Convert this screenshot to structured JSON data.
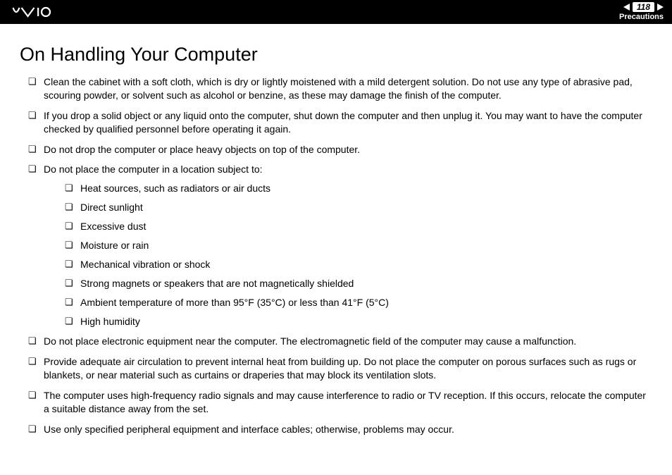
{
  "header": {
    "page_number": "118",
    "section": "Precautions"
  },
  "title": "On Handling Your Computer",
  "items": [
    "Clean the cabinet with a soft cloth, which is dry or lightly moistened with a mild detergent solution. Do not use any type of abrasive pad, scouring powder, or solvent such as alcohol or benzine, as these may damage the finish of the computer.",
    "If you drop a solid object or any liquid onto the computer, shut down the computer and then unplug it. You may want to have the computer checked by qualified personnel before operating it again.",
    "Do not drop the computer or place heavy objects on top of the computer.",
    "Do not place the computer in a location subject to:",
    "Do not place electronic equipment near the computer. The electromagnetic field of the computer may cause a malfunction.",
    "Provide adequate air circulation to prevent internal heat from building up. Do not place the computer on porous surfaces such as rugs or blankets, or near material such as curtains or draperies that may block its ventilation slots.",
    "The computer uses high-frequency radio signals and may cause interference to radio or TV reception. If this occurs, relocate the computer a suitable distance away from the set.",
    "Use only specified peripheral equipment and interface cables; otherwise, problems may occur."
  ],
  "subitems": [
    "Heat sources, such as radiators or air ducts",
    "Direct sunlight",
    "Excessive dust",
    "Moisture or rain",
    "Mechanical vibration or shock",
    "Strong magnets or speakers that are not magnetically shielded",
    "Ambient temperature of more than 95°F (35°C) or less than 41°F (5°C)",
    "High humidity"
  ]
}
